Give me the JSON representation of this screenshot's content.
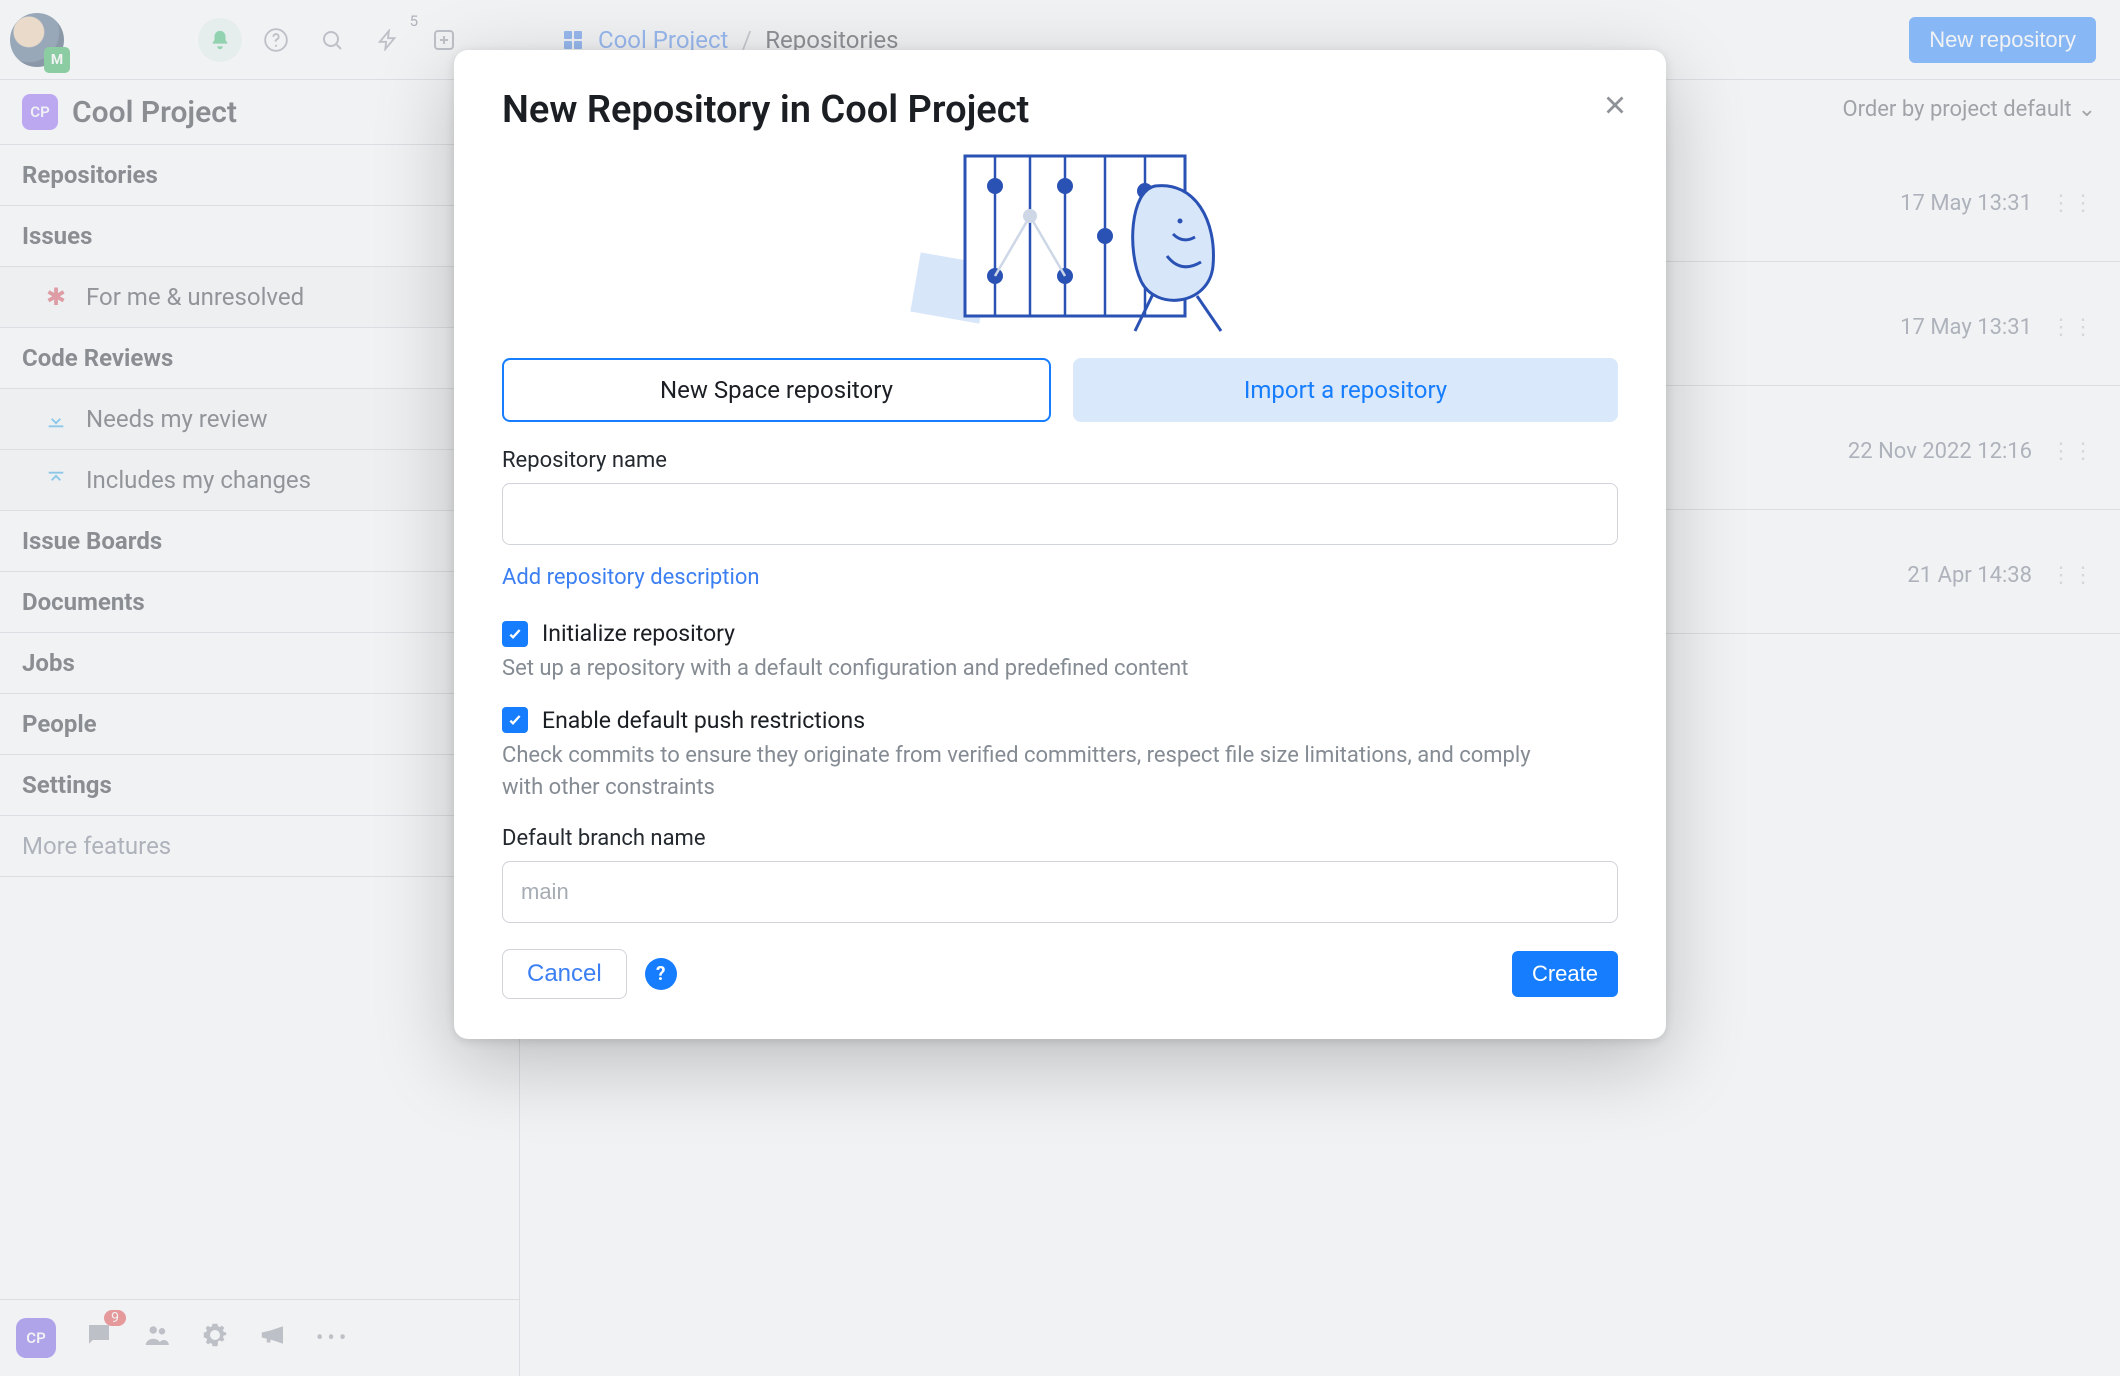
{
  "header": {
    "notification_sup": "5",
    "breadcrumb_project": "Cool Project",
    "breadcrumb_tail": "Repositories",
    "new_repo_button": "New repository",
    "order_by_label": "Order by",
    "order_by_value": "project default"
  },
  "sidebar": {
    "project_badge": "CP",
    "project_title": "Cool Project",
    "items": {
      "repositories": "Repositories",
      "issues": "Issues",
      "for_me": "For me & unresolved",
      "code_reviews": "Code Reviews",
      "needs_review": "Needs my review",
      "includes_changes": "Includes my changes",
      "issue_boards": "Issue Boards",
      "documents": "Documents",
      "jobs": "Jobs",
      "people": "People",
      "settings": "Settings",
      "more": "More features"
    },
    "bottom": {
      "cp": "CP",
      "chat_badge": "9"
    }
  },
  "main_rows": [
    {
      "date": "17 May 13:31",
      "starred": true
    },
    {
      "date": "17 May 13:31",
      "starred": true
    },
    {
      "date": "22 Nov 2022 12:16",
      "starred": false
    },
    {
      "date": "21 Apr 14:38",
      "starred": false
    }
  ],
  "modal": {
    "title": "New Repository in Cool Project",
    "tab_new": "New Space repository",
    "tab_import": "Import a repository",
    "repo_name_label": "Repository name",
    "add_desc": "Add repository description",
    "init_label": "Initialize repository",
    "init_helper": "Set up a repository with a default configuration and predefined content",
    "push_label": "Enable default push restrictions",
    "push_helper": "Check commits to ensure they originate from verified committers, respect file size limitations, and comply with other constraints",
    "branch_label": "Default branch name",
    "branch_placeholder": "main",
    "cancel": "Cancel",
    "create": "Create"
  }
}
